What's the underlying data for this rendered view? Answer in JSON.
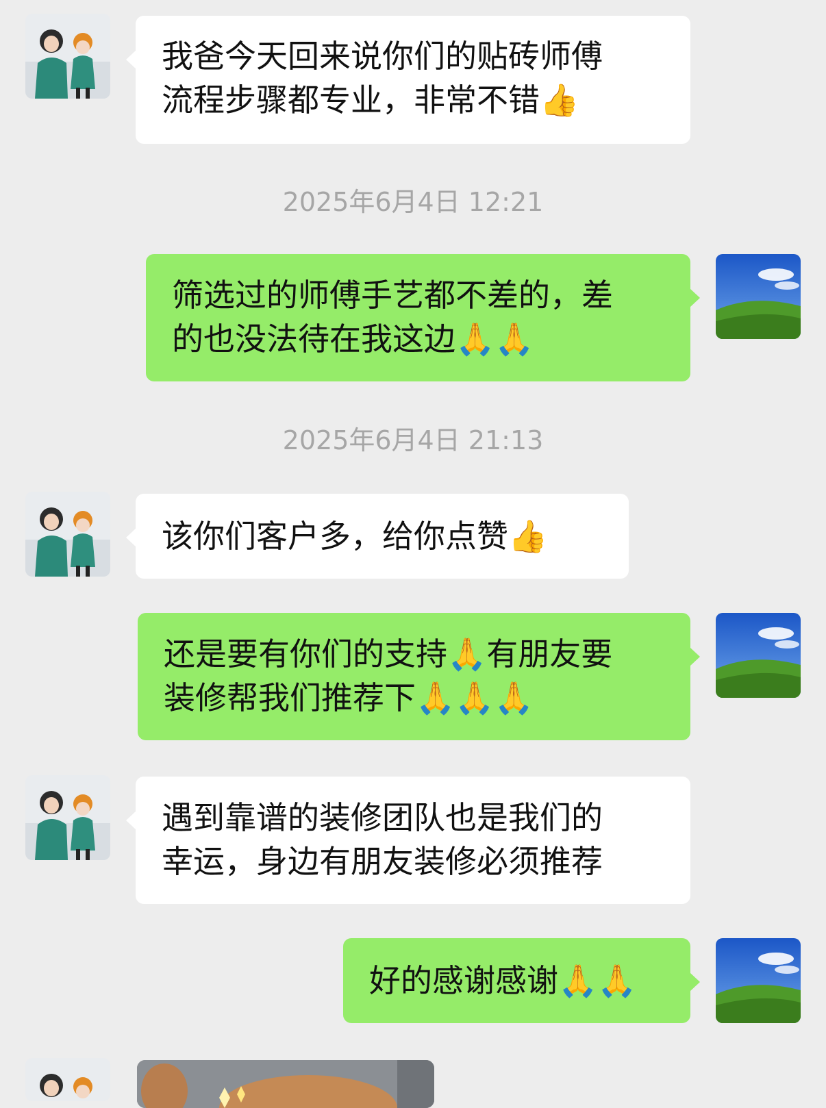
{
  "messages": [
    {
      "sender": "other",
      "text": "我爸今天回来说你们的贴砖师傅\n流程步骤都专业，非常不错👍"
    },
    {
      "timestamp": "2025年6月4日 12:21"
    },
    {
      "sender": "me",
      "text": "筛选过的师傅手艺都不差的，差\n的也没法待在我这边🙏🙏"
    },
    {
      "timestamp": "2025年6月4日 21:13"
    },
    {
      "sender": "other",
      "text": "该你们客户多，给你点赞👍"
    },
    {
      "sender": "me",
      "text": "还是要有你们的支持🙏有朋友要\n装修帮我们推荐下🙏🙏🙏"
    },
    {
      "sender": "other",
      "text": "遇到靠谱的装修团队也是我们的\n幸运，身边有朋友装修必须推荐"
    },
    {
      "sender": "me",
      "text": "好的感谢感谢🙏🙏"
    },
    {
      "sender": "other",
      "type": "image"
    }
  ],
  "colors": {
    "background": "#ededed",
    "incoming_bubble": "#ffffff",
    "outgoing_bubble": "#95ec69",
    "timestamp_text": "#a6a6a6"
  },
  "icons": {
    "other_avatar": "photo-of-two-people",
    "my_avatar": "green-hill-blue-sky"
  }
}
